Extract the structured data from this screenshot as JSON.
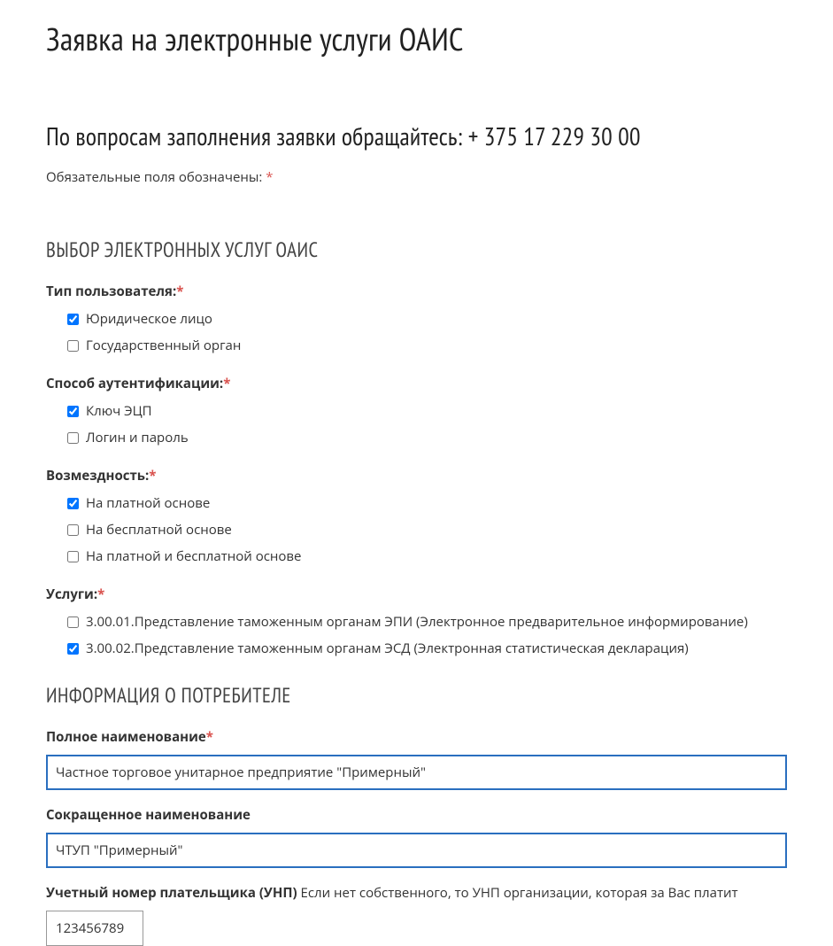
{
  "pageTitle": "Заявка на электронные услуги ОАИС",
  "subTitle": "По вопросам заполнения заявки обращайтесь: + 375 17 229 30 00",
  "mandatoryNote": "Обязательные поля обозначены: ",
  "mandatoryMark": "*",
  "section1": {
    "title": "ВЫБОР ЭЛЕКТРОННЫХ УСЛУГ ОАИС",
    "userType": {
      "label": "Тип пользователя:",
      "required": "*",
      "options": [
        {
          "label": "Юридическое лицо",
          "checked": true
        },
        {
          "label": "Государственный орган",
          "checked": false
        }
      ]
    },
    "auth": {
      "label": "Способ аутентификации:",
      "required": "*",
      "options": [
        {
          "label": "Ключ ЭЦП",
          "checked": true
        },
        {
          "label": "Логин и пароль",
          "checked": false
        }
      ]
    },
    "payment": {
      "label": "Возмездность:",
      "required": "*",
      "options": [
        {
          "label": "На платной основе",
          "checked": true
        },
        {
          "label": "На бесплатной основе",
          "checked": false
        },
        {
          "label": "На платной и бесплатной основе",
          "checked": false
        }
      ]
    },
    "services": {
      "label": "Услуги:",
      "required": "*",
      "options": [
        {
          "label": "3.00.01.Представление таможенным органам ЭПИ (Электронное предварительное информирование)",
          "checked": false
        },
        {
          "label": "3.00.02.Представление таможенным органам ЭСД (Электронная статистическая декларация)",
          "checked": true
        }
      ]
    }
  },
  "section2": {
    "title": "ИНФОРМАЦИЯ О ПОТРЕБИТЕЛЕ",
    "fullName": {
      "label": "Полное наименование",
      "required": "*",
      "value": "Частное торговое унитарное предприятие \"Примерный\""
    },
    "shortName": {
      "label": "Сокращенное наименование",
      "value": "ЧТУП \"Примерный\""
    },
    "unp": {
      "label": "Учетный номер плательщика (УНП) ",
      "hint": "Если нет собственного, то УНП организации, которая за Вас платит",
      "value": "123456789"
    }
  }
}
